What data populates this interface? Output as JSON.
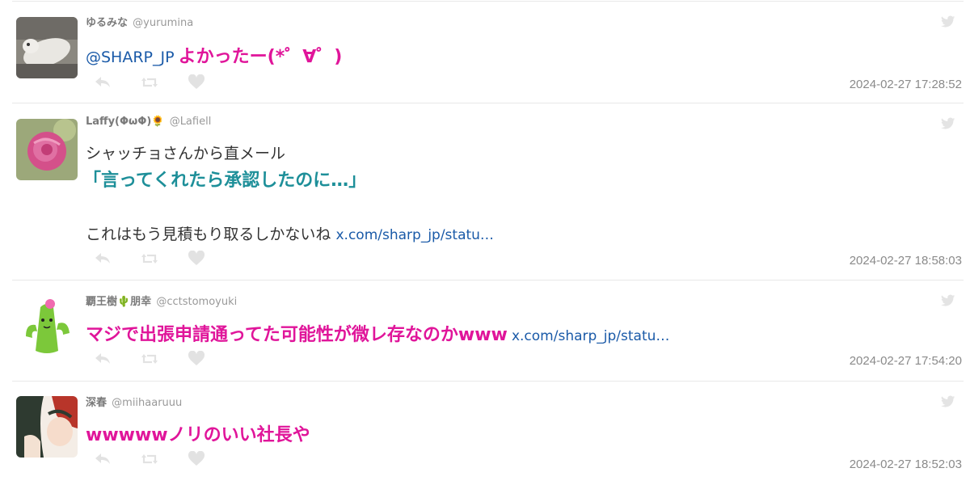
{
  "tweets": [
    {
      "name": "ゆるみな",
      "handle": "@yurumina",
      "mention": "@SHARP_JP",
      "text": "よかったー(*゜∀゜)",
      "timestamp": "2024-02-27 17:28:52"
    },
    {
      "name": "Laffy(ΦωΦ)🌻",
      "handle": "@Lafiell",
      "line1": "シャッチョさんから直メール",
      "line2": "「言ってくれたら承認したのに…」",
      "line3": "これはもう見積もり取るしかないね",
      "link": "x.com/sharp_jp/statu…",
      "timestamp": "2024-02-27 18:58:03"
    },
    {
      "name": "覇王樹🌵朋幸",
      "handle": "@cctstomoyuki",
      "text": "マジで出張申請通ってた可能性が微レ存なのかwww",
      "link": "x.com/sharp_jp/statu…",
      "timestamp": "2024-02-27 17:54:20"
    },
    {
      "name": "深春",
      "handle": "@miihaaruuu",
      "text": "wwwwwノリのいい社長や",
      "timestamp": "2024-02-27 18:52:03"
    }
  ],
  "icons": {
    "reply": "reply-icon",
    "retweet": "retweet-icon",
    "like": "heart-icon",
    "brand": "twitter-bird-icon"
  },
  "colors": {
    "mention_link": "#1a5aa8",
    "pink_text": "#e0159a",
    "teal_text": "#1d8f99",
    "icon_gray": "#e2e2e2",
    "timestamp": "#8a8a8a"
  }
}
